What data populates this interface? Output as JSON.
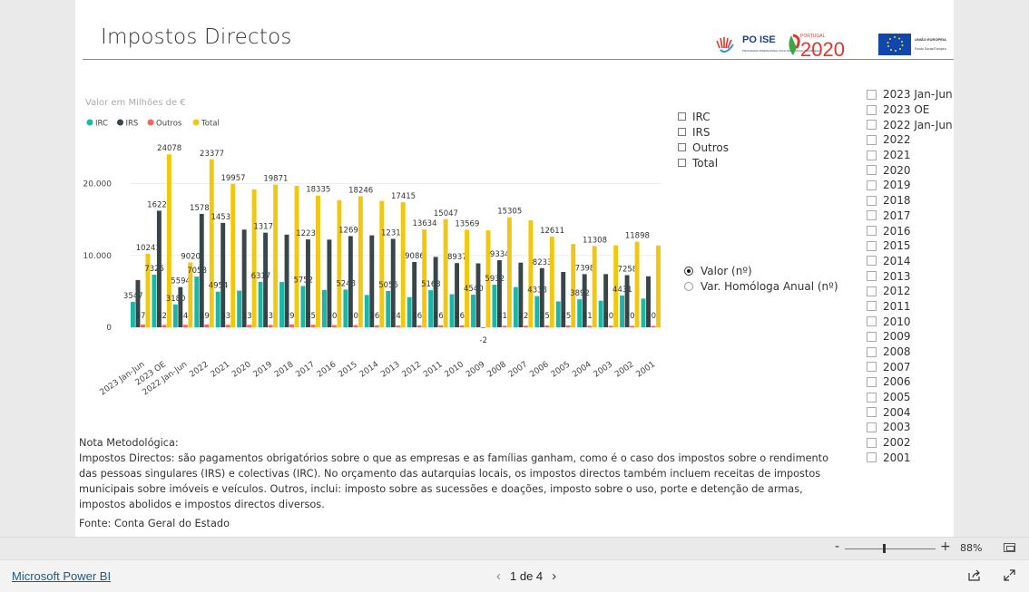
{
  "page": {
    "title": "Impostos Directos"
  },
  "logos": {
    "poise_text": "PO ISE",
    "poise_sub": "PROGRAMA OPERACIONAL INCLUSÃO SOCIAL E EMPREGO",
    "portugal_text": "PORTUGAL",
    "p2020_text": "2020",
    "eu_text": "UNIÃO EUROPEIA",
    "eu_sub": "Fundo Social Europeu"
  },
  "chart_data": {
    "type": "bar",
    "title": "Valor em Milhões de €",
    "ylim": [
      0,
      26000
    ],
    "yticks": [
      "0",
      "10.000",
      "20.000"
    ],
    "ytick_values": [
      0,
      10000,
      20000
    ],
    "categories": [
      "2023 Jan-Jun",
      "2023 OE",
      "2022 Jan-Jun",
      "2022",
      "2021",
      "2020",
      "2019",
      "2018",
      "2017",
      "2016",
      "2015",
      "2014",
      "2013",
      "2012",
      "2011",
      "2010",
      "2009",
      "2008",
      "2007",
      "2006",
      "2005",
      "2004",
      "2003",
      "2002",
      "2001"
    ],
    "series": [
      {
        "name": "IRC",
        "color": "#1ab7a6",
        "values": [
          3547,
          7325,
          3180,
          7058,
          4954,
          5100,
          6317,
          6300,
          5752,
          5200,
          5248,
          4500,
          5056,
          4200,
          5163,
          4600,
          4540,
          5932,
          5600,
          4338,
          3600,
          3892,
          3700,
          4431,
          4000
        ],
        "labels": [
          "3547",
          "7325",
          "3180",
          "7058",
          "4954",
          "",
          "6317",
          "",
          "5752",
          "",
          "5248",
          "",
          "5056",
          "",
          "5163",
          "",
          "4540",
          "5932",
          "",
          "4338",
          "",
          "3892",
          "",
          "4431",
          ""
        ]
      },
      {
        "name": "IRS",
        "color": "#374649",
        "values": [
          6577,
          16224,
          5594,
          15784,
          14534,
          13600,
          13171,
          12900,
          12230,
          12200,
          12696,
          12800,
          12312,
          9086,
          9800,
          8937,
          8900,
          9334,
          9000,
          8233,
          7700,
          7398,
          7400,
          7258,
          7100
        ],
        "labels": [
          "",
          "16224",
          "5594",
          "15784",
          "14534",
          "",
          "13171",
          "",
          "12230",
          "",
          "12696",
          "",
          "12312",
          "9086",
          "",
          "8937",
          "",
          "9334",
          "",
          "8233",
          "",
          "7398",
          "",
          "7258",
          ""
        ]
      },
      {
        "name": "Outros",
        "color": "#fd625e",
        "values": [
          377,
          324,
          346,
          395,
          339,
          338,
          333,
          398,
          353,
          303,
          302,
          266,
          249,
          268,
          268,
          261,
          -2,
          219,
          223,
          254,
          255,
          218,
          208,
          209,
          207
        ],
        "labels": [
          "377",
          "324",
          "346",
          "395",
          "339",
          "338",
          "333",
          "398",
          "353",
          "303",
          "302",
          "266",
          "249",
          "268",
          "268",
          "261",
          "-2",
          "219",
          "223",
          "254",
          "255",
          "218",
          "208",
          "209",
          "207"
        ]
      },
      {
        "name": "Total",
        "color": "#f2c80f",
        "values": [
          10241,
          24078,
          9020,
          23377,
          19957,
          19200,
          19871,
          19700,
          18335,
          17700,
          18246,
          17600,
          17415,
          13634,
          15047,
          13569,
          13500,
          15305,
          14900,
          12611,
          11600,
          11308,
          11400,
          11898,
          11400
        ],
        "labels": [
          "10241",
          "24078",
          "9020",
          "23377",
          "19957",
          "",
          "19871",
          "",
          "18335",
          "",
          "18246",
          "",
          "17415",
          "13634",
          "15047",
          "13569",
          "",
          "15305",
          "",
          "12611",
          "",
          "11308",
          "",
          "11898",
          ""
        ]
      }
    ]
  },
  "measure_slicer": {
    "items": [
      "IRC",
      "IRS",
      "Outros",
      "Total"
    ]
  },
  "mode_radio": {
    "items": [
      "Valor (nº)",
      "Var. Homóloga Anual (nº)"
    ],
    "selected": 0
  },
  "note": {
    "heading": "Nota Metodológica:",
    "text": "Impostos Directos: são pagamentos obrigatórios sobre o que as empresas e as famílias ganham, como é o caso dos impostos sobre o rendimento das pessoas singulares (IRS) e colectivas (IRC). No orçamento das autarquias locais, os impostos directos também incluem receitas de impostos municipais sobre imóveis e veículos. Outros, inclui: imposto sobre as sucessões e doações, imposto sobre o uso, porte e detenção de armas, impostos abolidos e impostos directos diversos.",
    "source": "Fonte: Conta Geral do Estado"
  },
  "year_slicer": {
    "items": [
      "2023 Jan-Jun",
      "2023 OE",
      "2022 Jan-Jun",
      "2022",
      "2021",
      "2020",
      "2019",
      "2018",
      "2017",
      "2016",
      "2015",
      "2014",
      "2013",
      "2012",
      "2011",
      "2010",
      "2009",
      "2008",
      "2007",
      "2006",
      "2005",
      "2004",
      "2003",
      "2002",
      "2001"
    ]
  },
  "zoom": {
    "minus": "-",
    "plus": "+",
    "level": "88%"
  },
  "footer": {
    "brand_link": "Microsoft Power BI",
    "page_indicator": "1 de 4",
    "prev": "‹",
    "next": "›"
  }
}
